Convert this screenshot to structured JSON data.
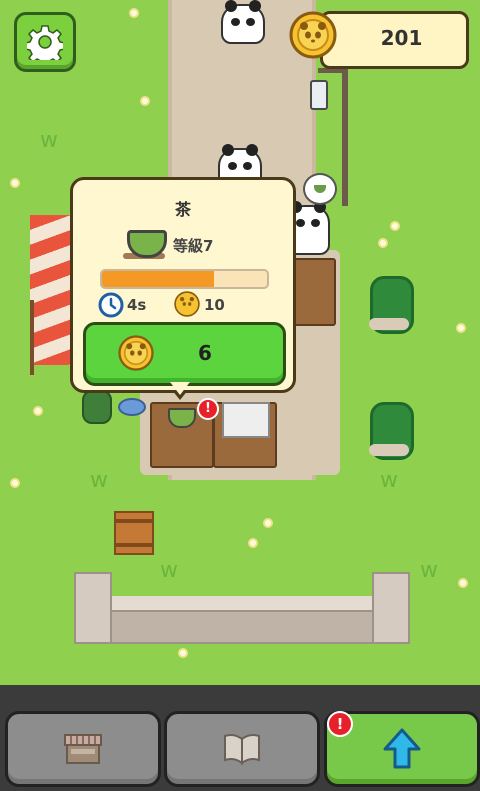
{
  "hud": {
    "coin_count": "201"
  },
  "popup": {
    "title": "茶",
    "level": "等級7",
    "progress": 0.68,
    "time": "4s",
    "coin_reward": "10",
    "sell_value": "6"
  },
  "alerts": {
    "stall": "!",
    "upgrade": "!"
  },
  "colors": {
    "grass": "#8fd14f",
    "path": "#d8c9b3",
    "button_green": "#5bd43e",
    "progress_fill": "#f49a24",
    "popup_bg": "#fff7cf",
    "coin": "#f5c330"
  },
  "icons": [
    "gear-icon",
    "coin-icon",
    "clock-icon",
    "tea-cup-icon",
    "shop-stall-icon",
    "book-icon",
    "up-arrow-icon",
    "alert-icon"
  ]
}
